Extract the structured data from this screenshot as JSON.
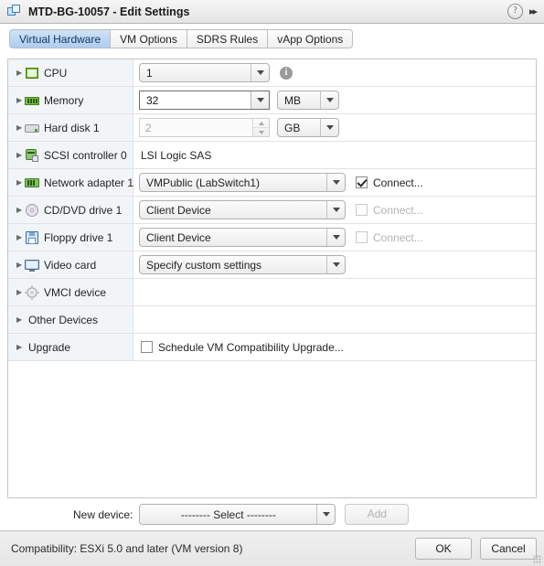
{
  "window": {
    "title": "MTD-BG-10057 - Edit Settings",
    "icon": "vm-icon",
    "help_label": "?",
    "expand_label": "▸▸"
  },
  "tabs": [
    {
      "label": "Virtual Hardware",
      "active": true
    },
    {
      "label": "VM Options",
      "active": false
    },
    {
      "label": "SDRS Rules",
      "active": false
    },
    {
      "label": "vApp Options",
      "active": false
    }
  ],
  "rows": [
    {
      "label": "CPU",
      "icon": "cpu-icon"
    },
    {
      "label": "Memory",
      "icon": "memory-icon"
    },
    {
      "label": "Hard disk 1",
      "icon": "hard-disk-icon"
    },
    {
      "label": "SCSI controller 0",
      "icon": "scsi-controller-icon"
    },
    {
      "label": "Network adapter 1",
      "icon": "network-adapter-icon"
    },
    {
      "label": "CD/DVD drive 1",
      "icon": "cd-dvd-icon"
    },
    {
      "label": "Floppy drive 1",
      "icon": "floppy-icon"
    },
    {
      "label": "Video card",
      "icon": "video-card-icon"
    },
    {
      "label": "VMCI device",
      "icon": "vmci-gear-icon"
    },
    {
      "label": "Other Devices",
      "icon": ""
    },
    {
      "label": "Upgrade",
      "icon": ""
    }
  ],
  "controls": {
    "cpu_value": "1",
    "memory_value": "32",
    "memory_unit": "MB",
    "harddisk_value": "2",
    "harddisk_unit": "GB",
    "scsi_controller_type": "LSI Logic SAS",
    "network_adapter_value": "VMPublic (LabSwitch1)",
    "network_connect_label": "Connect...",
    "cddvd_value": "Client Device",
    "cddvd_connect_label": "Connect...",
    "floppy_value": "Client Device",
    "floppy_connect_label": "Connect...",
    "video_card_value": "Specify custom settings",
    "upgrade_label": "Schedule VM Compatibility Upgrade...",
    "cpu_info_icon": "i"
  },
  "new_device": {
    "label": "New device:",
    "selected": "-------- Select --------",
    "add_label": "Add"
  },
  "footer": {
    "compatibility": "Compatibility: ESXi 5.0 and later (VM version 8)",
    "ok_label": "OK",
    "cancel_label": "Cancel"
  }
}
